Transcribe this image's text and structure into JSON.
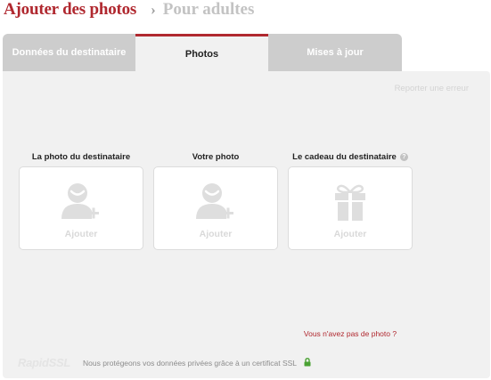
{
  "header": {
    "title": "Ajouter des photos",
    "separator": "›",
    "next_step": "Pour adultes"
  },
  "tabs": [
    {
      "label": "Données du destinataire",
      "active": false
    },
    {
      "label": "Photos",
      "active": true
    },
    {
      "label": "Mises à jour",
      "active": false
    }
  ],
  "panel": {
    "report_link": "Reporter une erreur",
    "cards": [
      {
        "label": "La photo du destinataire",
        "action": "Ajouter",
        "icon": "person-add-icon"
      },
      {
        "label": "Votre photo",
        "action": "Ajouter",
        "icon": "person-add-icon"
      },
      {
        "label": "Le cadeau du destinataire",
        "action": "Ajouter",
        "icon": "gift-icon",
        "help": "?"
      }
    ],
    "no_photo_link": "Vous n'avez pas de photo ?"
  },
  "footer": {
    "logo": "RapidSSL",
    "note": "Nous protégeons vos données privées grâce à un certificat SSL",
    "lock_icon": "lock-icon"
  },
  "colors": {
    "accent": "#b0282f",
    "tab_inactive": "#cdcdcd",
    "panel_bg": "#f1f1f1",
    "lock": "#4aa233"
  }
}
